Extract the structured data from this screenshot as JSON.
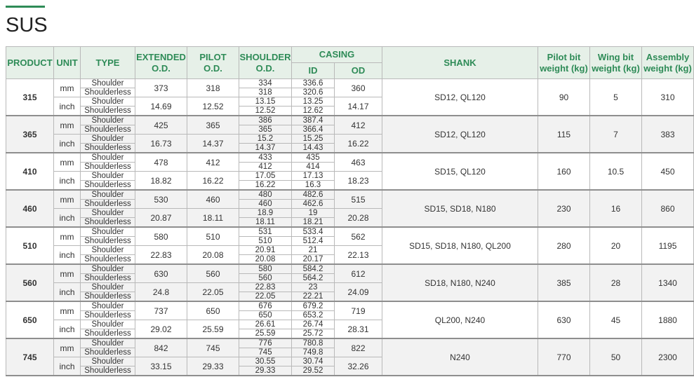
{
  "title": "SUS",
  "accent_color": "#2e8b57",
  "header_bg": "#e6f0e8",
  "headers": {
    "product": "PRODUCT",
    "unit": "UNIT",
    "type": "TYPE",
    "extended_1": "EXTENDED",
    "extended_2": "O.D.",
    "pilot_1": "PILOT",
    "pilot_2": "O.D.",
    "shoulder_1": "SHOULDER",
    "shoulder_2": "O.D.",
    "casing": "CASING",
    "casing_id": "ID",
    "casing_od": "OD",
    "shank": "SHANK",
    "pilot_bit_1": "Pilot bit",
    "pilot_bit_2": "weight (kg)",
    "wing_bit_1": "Wing bit",
    "wing_bit_2": "weight (kg)",
    "assembly_1": "Assembly",
    "assembly_2": "weight (kg)"
  },
  "type_labels": {
    "a": "Shoulder",
    "b": "Shoulderless"
  },
  "units": {
    "mm": "mm",
    "inch": "inch"
  },
  "products": [
    {
      "product": "315",
      "shank": "SD12, QL120",
      "pilot_w": "90",
      "wing_w": "5",
      "assembly_w": "310",
      "mm": {
        "extended": "373",
        "pilot": "318",
        "shoulder": [
          "334",
          "318"
        ],
        "casing_id": [
          "336.6",
          "320.6"
        ],
        "casing_od": "360"
      },
      "inch": {
        "extended": "14.69",
        "pilot": "12.52",
        "shoulder": [
          "13.15",
          "12.52"
        ],
        "casing_id": [
          "13.25",
          "12.62"
        ],
        "casing_od": "14.17"
      }
    },
    {
      "product": "365",
      "shank": "SD12, QL120",
      "pilot_w": "115",
      "wing_w": "7",
      "assembly_w": "383",
      "mm": {
        "extended": "425",
        "pilot": "365",
        "shoulder": [
          "386",
          "365"
        ],
        "casing_id": [
          "387.4",
          "366.4"
        ],
        "casing_od": "412"
      },
      "inch": {
        "extended": "16.73",
        "pilot": "14.37",
        "shoulder": [
          "15.2",
          "14.37"
        ],
        "casing_id": [
          "15.25",
          "14.43"
        ],
        "casing_od": "16.22"
      }
    },
    {
      "product": "410",
      "shank": "SD15, QL120",
      "pilot_w": "160",
      "wing_w": "10.5",
      "assembly_w": "450",
      "mm": {
        "extended": "478",
        "pilot": "412",
        "shoulder": [
          "433",
          "412"
        ],
        "casing_id": [
          "435",
          "414"
        ],
        "casing_od": "463"
      },
      "inch": {
        "extended": "18.82",
        "pilot": "16.22",
        "shoulder": [
          "17.05",
          "16.22"
        ],
        "casing_id": [
          "17.13",
          "16.3"
        ],
        "casing_od": "18.23"
      }
    },
    {
      "product": "460",
      "shank": "SD15, SD18, N180",
      "pilot_w": "230",
      "wing_w": "16",
      "assembly_w": "860",
      "mm": {
        "extended": "530",
        "pilot": "460",
        "shoulder": [
          "480",
          "460"
        ],
        "casing_id": [
          "482.6",
          "462.6"
        ],
        "casing_od": "515"
      },
      "inch": {
        "extended": "20.87",
        "pilot": "18.11",
        "shoulder": [
          "18.9",
          "18.11"
        ],
        "casing_id": [
          "19",
          "18.21"
        ],
        "casing_od": "20.28"
      }
    },
    {
      "product": "510",
      "shank": "SD15, SD18, N180, QL200",
      "pilot_w": "280",
      "wing_w": "20",
      "assembly_w": "1195",
      "mm": {
        "extended": "580",
        "pilot": "510",
        "shoulder": [
          "531",
          "510"
        ],
        "casing_id": [
          "533.4",
          "512.4"
        ],
        "casing_od": "562"
      },
      "inch": {
        "extended": "22.83",
        "pilot": "20.08",
        "shoulder": [
          "20.91",
          "20.08"
        ],
        "casing_id": [
          "21",
          "20.17"
        ],
        "casing_od": "22.13"
      }
    },
    {
      "product": "560",
      "shank": "SD18, N180, N240",
      "pilot_w": "385",
      "wing_w": "28",
      "assembly_w": "1340",
      "mm": {
        "extended": "630",
        "pilot": "560",
        "shoulder": [
          "580",
          "560"
        ],
        "casing_id": [
          "584.2",
          "564.2"
        ],
        "casing_od": "612"
      },
      "inch": {
        "extended": "24.8",
        "pilot": "22.05",
        "shoulder": [
          "22.83",
          "22.05"
        ],
        "casing_id": [
          "23",
          "22.21"
        ],
        "casing_od": "24.09"
      }
    },
    {
      "product": "650",
      "shank": "QL200, N240",
      "pilot_w": "630",
      "wing_w": "45",
      "assembly_w": "1880",
      "mm": {
        "extended": "737",
        "pilot": "650",
        "shoulder": [
          "676",
          "650"
        ],
        "casing_id": [
          "679.2",
          "653.2"
        ],
        "casing_od": "719"
      },
      "inch": {
        "extended": "29.02",
        "pilot": "25.59",
        "shoulder": [
          "26.61",
          "25.59"
        ],
        "casing_id": [
          "26.74",
          "25.72"
        ],
        "casing_od": "28.31"
      }
    },
    {
      "product": "745",
      "shank": "N240",
      "pilot_w": "770",
      "wing_w": "50",
      "assembly_w": "2300",
      "mm": {
        "extended": "842",
        "pilot": "745",
        "shoulder": [
          "776",
          "745"
        ],
        "casing_id": [
          "780.8",
          "749.8"
        ],
        "casing_od": "822"
      },
      "inch": {
        "extended": "33.15",
        "pilot": "29.33",
        "shoulder": [
          "30.55",
          "29.33"
        ],
        "casing_id": [
          "30.74",
          "29.52"
        ],
        "casing_od": "32.26"
      }
    }
  ]
}
